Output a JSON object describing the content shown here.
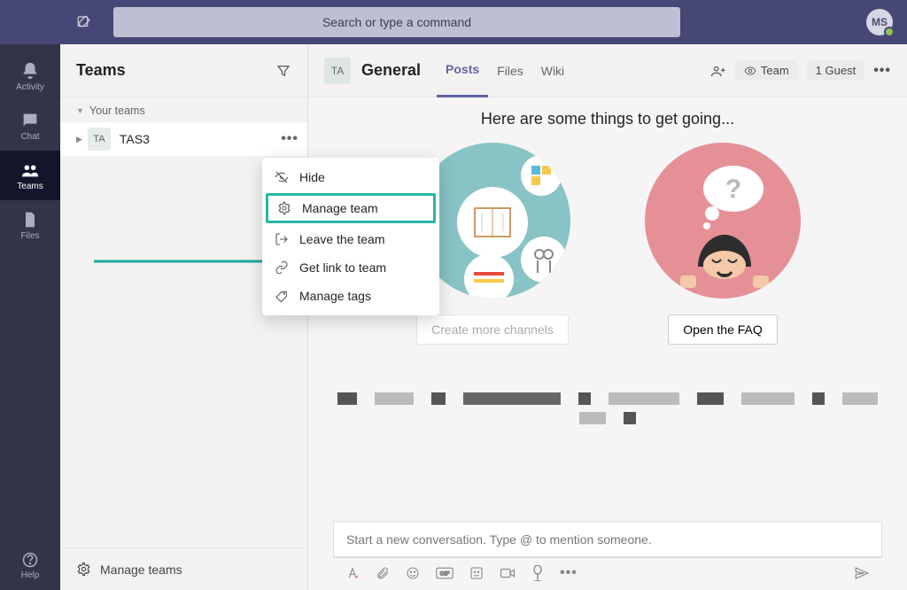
{
  "topbar": {
    "search_placeholder": "Search or type a command",
    "avatar_initials": "MS"
  },
  "rail": {
    "items": [
      {
        "label": "Activity"
      },
      {
        "label": "Chat"
      },
      {
        "label": "Teams"
      },
      {
        "label": "Files"
      }
    ],
    "help_label": "Help"
  },
  "left": {
    "title": "Teams",
    "section_label": "Your teams",
    "team": {
      "badge": "TA",
      "name": "TAS3"
    },
    "manage_teams": "Manage teams"
  },
  "context_menu": {
    "items": [
      {
        "label": "Hide"
      },
      {
        "label": "Manage team"
      },
      {
        "label": "Leave the team"
      },
      {
        "label": "Get link to team"
      },
      {
        "label": "Manage tags"
      }
    ]
  },
  "channel": {
    "badge": "TA",
    "title": "General",
    "tabs": [
      {
        "label": "Posts"
      },
      {
        "label": "Files"
      },
      {
        "label": "Wiki"
      }
    ],
    "visibility": "Team",
    "guests": "1 Guest"
  },
  "content": {
    "hero": "Here are some things to get going...",
    "btn_channels": "Create more channels",
    "btn_faq": "Open the FAQ"
  },
  "composer": {
    "placeholder": "Start a new conversation. Type @ to mention someone."
  }
}
